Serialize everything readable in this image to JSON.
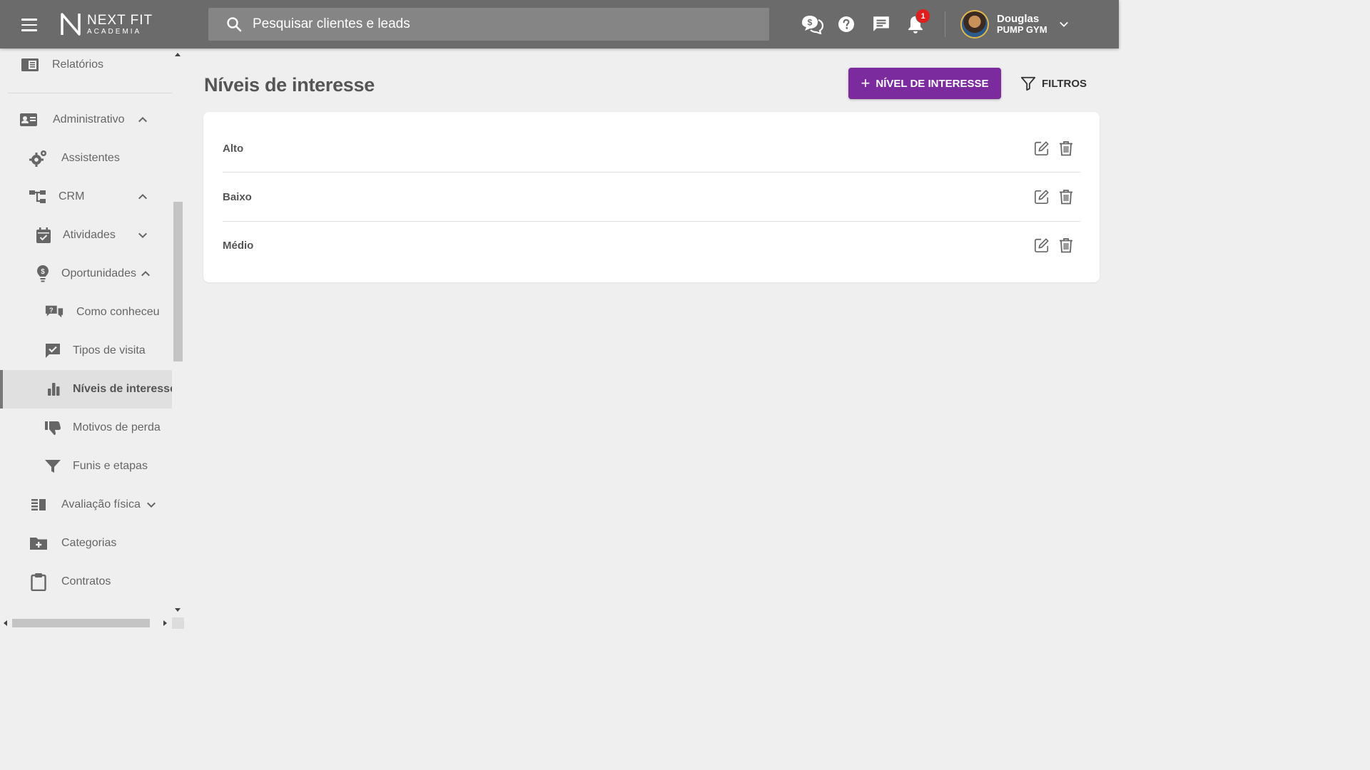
{
  "header": {
    "brand_name": "NEXT FIT",
    "brand_sub": "ACADEMIA",
    "search_placeholder": "Pesquisar clientes e leads",
    "notifications_count": "1",
    "user_name": "Douglas",
    "user_org": "PUMP GYM"
  },
  "sidebar": {
    "items": [
      {
        "label": "Relatórios"
      },
      {
        "label": "Administrativo"
      },
      {
        "label": "Assistentes"
      },
      {
        "label": "CRM"
      },
      {
        "label": "Atividades"
      },
      {
        "label": "Oportunidades"
      },
      {
        "label": "Como conheceu"
      },
      {
        "label": "Tipos de visita"
      },
      {
        "label": "Níveis de interesse"
      },
      {
        "label": "Motivos de perda"
      },
      {
        "label": "Funis e etapas"
      },
      {
        "label": "Avaliação física"
      },
      {
        "label": "Categorias"
      },
      {
        "label": "Contratos"
      }
    ]
  },
  "main": {
    "title": "Níveis de interesse",
    "add_button": "NÍVEL DE INTERESSE",
    "filter_button": "FILTROS",
    "rows": [
      {
        "name": "Alto"
      },
      {
        "name": "Baixo"
      },
      {
        "name": "Médio"
      }
    ]
  },
  "colors": {
    "topbar": "#6b6b6b",
    "accent": "#7b2b9e",
    "badge": "#e11d1d"
  }
}
